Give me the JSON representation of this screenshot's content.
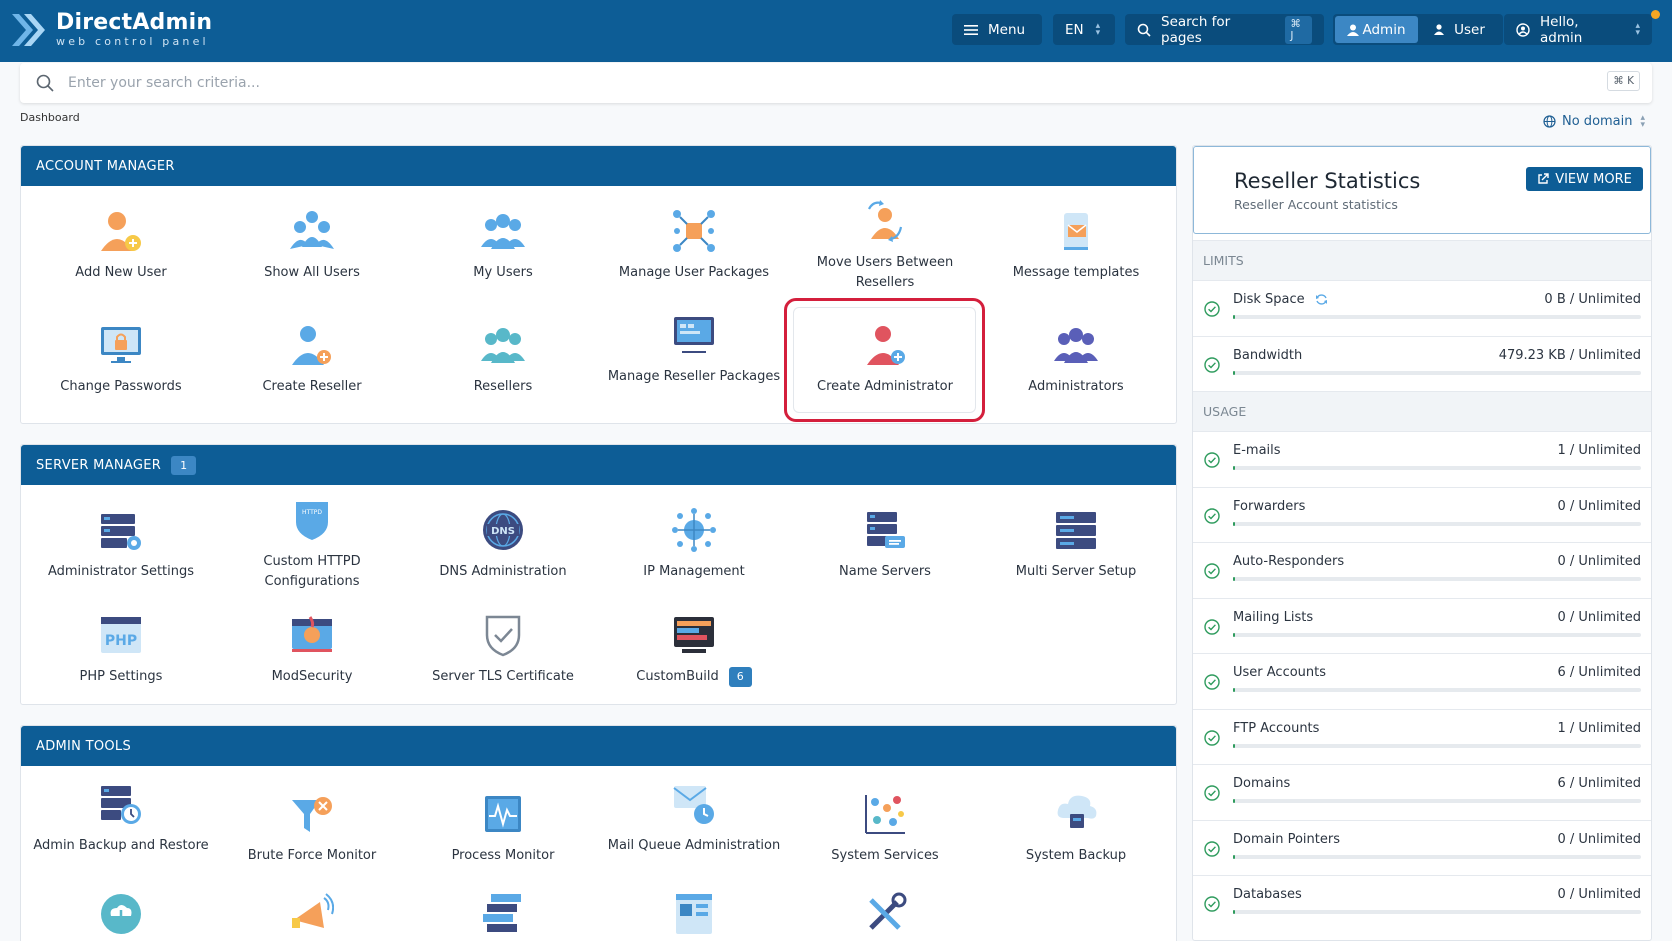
{
  "header": {
    "logo_title": "DirectAdmin",
    "logo_subtitle": "web control panel",
    "menu_label": "Menu",
    "language": "EN",
    "search_pages_label": "Search for pages",
    "search_pages_shortcut": "⌘ J",
    "role_admin": "Admin",
    "role_user": "User",
    "greeting": "Hello, admin"
  },
  "search": {
    "placeholder": "Enter your search criteria...",
    "shortcut": "⌘ K"
  },
  "breadcrumb": "Dashboard",
  "domain_select": "No domain",
  "account_manager": {
    "title": "ACCOUNT MANAGER",
    "items": [
      "Add New User",
      "Show All Users",
      "My Users",
      "Manage User Packages",
      "Move Users Between Resellers",
      "Message templates",
      "Change Passwords",
      "Create Reseller",
      "Resellers",
      "Manage Reseller Packages",
      "Create Administrator",
      "Administrators"
    ]
  },
  "server_manager": {
    "title": "SERVER MANAGER",
    "badge": "1",
    "items": [
      "Administrator Settings",
      "Custom HTTPD Configurations",
      "DNS Administration",
      "IP Management",
      "Name Servers",
      "Multi Server Setup",
      "PHP Settings",
      "ModSecurity",
      "Server TLS Certificate",
      "CustomBuild"
    ],
    "custombuild_badge": "6",
    "icon_text": {
      "httpd": "HTTPD",
      "dns": "DNS",
      "php": "PHP"
    }
  },
  "admin_tools": {
    "title": "ADMIN TOOLS",
    "items": [
      "Admin Backup and Restore",
      "Brute Force Monitor",
      "Process Monitor",
      "Mail Queue Administration",
      "System Services",
      "System Backup"
    ]
  },
  "stats": {
    "title": "Reseller Statistics",
    "subtitle": "Reseller Account statistics",
    "view_more": "VIEW MORE",
    "limits_label": "LIMITS",
    "usage_label": "USAGE",
    "limits": [
      {
        "name": "Disk Space",
        "value": "0 B / Unlimited",
        "fill": 0.004
      },
      {
        "name": "Bandwidth",
        "value": "479.23 KB / Unlimited",
        "fill": 0.004
      }
    ],
    "usage": [
      {
        "name": "E-mails",
        "value": "1 / Unlimited",
        "fill": 0.004
      },
      {
        "name": "Forwarders",
        "value": "0 / Unlimited",
        "fill": 0.004
      },
      {
        "name": "Auto-Responders",
        "value": "0 / Unlimited",
        "fill": 0.004
      },
      {
        "name": "Mailing Lists",
        "value": "0 / Unlimited",
        "fill": 0.004
      },
      {
        "name": "User Accounts",
        "value": "6 / Unlimited",
        "fill": 0.004
      },
      {
        "name": "FTP Accounts",
        "value": "1 / Unlimited",
        "fill": 0.004
      },
      {
        "name": "Domains",
        "value": "6 / Unlimited",
        "fill": 0.004
      },
      {
        "name": "Domain Pointers",
        "value": "0 / Unlimited",
        "fill": 0.004
      },
      {
        "name": "Databases",
        "value": "0 / Unlimited",
        "fill": 0.004
      }
    ]
  },
  "colors": {
    "brand": "#0d5d96",
    "highlight": "#d41f3c",
    "accent": "#3c87c4",
    "ok": "#2e9b5d"
  }
}
